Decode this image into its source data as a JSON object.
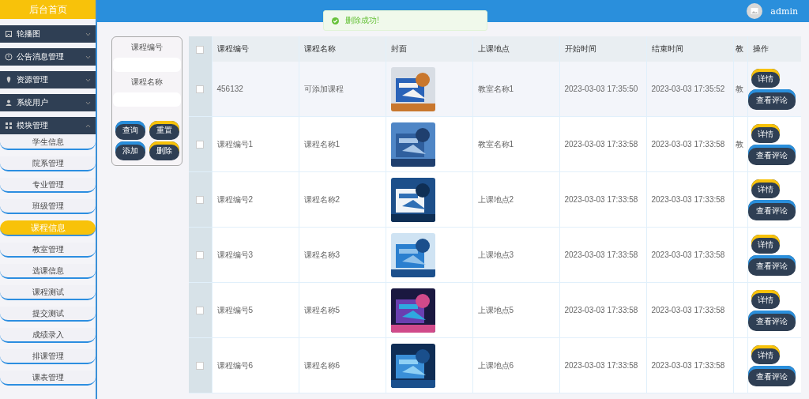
{
  "sidebar": {
    "home": "后台首页",
    "groups": [
      {
        "label": "轮播图",
        "expanded": false
      },
      {
        "label": "公告消息管理",
        "expanded": false
      },
      {
        "label": "资源管理",
        "expanded": false
      },
      {
        "label": "系统用户",
        "expanded": false
      },
      {
        "label": "模块管理",
        "expanded": true,
        "items": [
          {
            "label": "学生信息",
            "selected": false
          },
          {
            "label": "院系管理",
            "selected": false
          },
          {
            "label": "专业管理",
            "selected": false
          },
          {
            "label": "班级管理",
            "selected": false
          },
          {
            "label": "课程信息",
            "selected": true
          },
          {
            "label": "教室管理",
            "selected": false
          },
          {
            "label": "选课信息",
            "selected": false
          },
          {
            "label": "课程测试",
            "selected": false
          },
          {
            "label": "提交测试",
            "selected": false
          },
          {
            "label": "成绩录入",
            "selected": false
          },
          {
            "label": "排课管理",
            "selected": false
          },
          {
            "label": "课表管理",
            "selected": false
          }
        ]
      }
    ]
  },
  "header": {
    "user": "admin"
  },
  "toast": {
    "message": "删除成功!"
  },
  "search": {
    "fields": [
      {
        "label": "课程编号"
      },
      {
        "label": "课程名称"
      }
    ],
    "buttons": [
      "查询",
      "重置",
      "添加",
      "删除"
    ]
  },
  "table": {
    "all_checked": false,
    "columns": [
      "课程编号",
      "课程名称",
      "封面",
      "上课地点",
      "开始时间",
      "结束时间",
      "教",
      "操作"
    ],
    "rows": [
      {
        "checked": false,
        "cells": [
          "456132",
          "可添加课程",
          "",
          "教室名称1",
          "2023-03-03 17:35:50",
          "2023-03-03 17:35:52",
          "教"
        ],
        "actions": [
          "详情",
          "查看评论"
        ]
      },
      {
        "checked": false,
        "cells": [
          "课程编号1",
          "课程名称1",
          "",
          "教室名称1",
          "2023-03-03 17:33:58",
          "2023-03-03 17:33:58",
          "教"
        ],
        "actions": [
          "详情",
          "查看评论"
        ]
      },
      {
        "checked": false,
        "cells": [
          "课程编号2",
          "课程名称2",
          "",
          "上课地点2",
          "2023-03-03 17:33:58",
          "2023-03-03 17:33:58",
          ""
        ],
        "actions": [
          "详情",
          "查看评论"
        ]
      },
      {
        "checked": false,
        "cells": [
          "课程编号3",
          "课程名称3",
          "",
          "上课地点3",
          "2023-03-03 17:33:58",
          "2023-03-03 17:33:58",
          ""
        ],
        "actions": [
          "详情",
          "查看评论"
        ]
      },
      {
        "checked": false,
        "cells": [
          "课程编号5",
          "课程名称5",
          "",
          "上课地点5",
          "2023-03-03 17:33:58",
          "2023-03-03 17:33:58",
          ""
        ],
        "actions": [
          "详情",
          "查看评论"
        ]
      },
      {
        "checked": false,
        "cells": [
          "课程编号6",
          "课程名称6",
          "",
          "上课地点6",
          "2023-03-03 17:33:58",
          "2023-03-03 17:33:58",
          ""
        ],
        "actions": [
          "详情",
          "查看评论"
        ]
      }
    ]
  }
}
